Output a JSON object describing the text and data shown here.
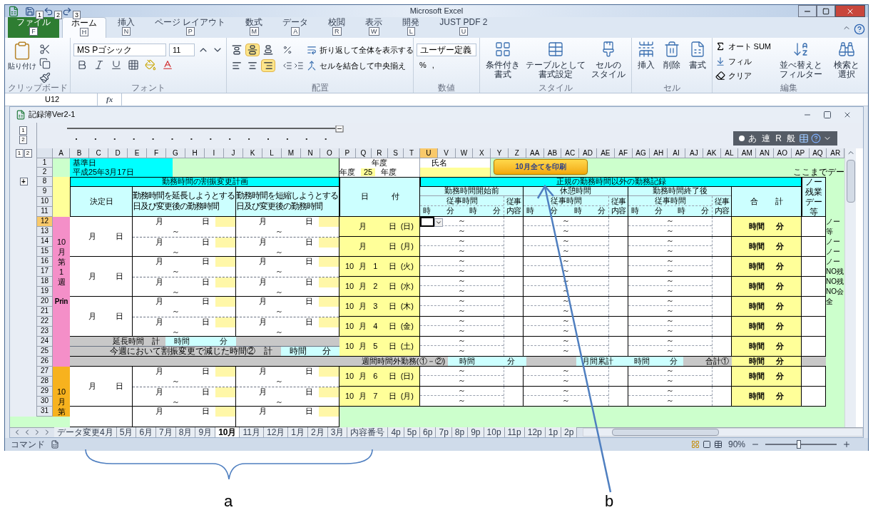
{
  "title_bar": {
    "title": "Microsoft Excel",
    "key_tips": [
      "1",
      "2",
      "3"
    ]
  },
  "ribbon": {
    "tabs": [
      {
        "label": "ファイル",
        "key": "F",
        "selected": false,
        "kind": "file"
      },
      {
        "label": "ホーム",
        "key": "H",
        "selected": true,
        "kind": "tab"
      },
      {
        "label": "挿入",
        "key": "N",
        "selected": false,
        "kind": "tab"
      },
      {
        "label": "ページ レイアウト",
        "key": "P",
        "selected": false,
        "kind": "tab"
      },
      {
        "label": "数式",
        "key": "M",
        "selected": false,
        "kind": "tab"
      },
      {
        "label": "データ",
        "key": "A",
        "selected": false,
        "kind": "tab"
      },
      {
        "label": "校閲",
        "key": "R",
        "selected": false,
        "kind": "tab"
      },
      {
        "label": "表示",
        "key": "W",
        "selected": false,
        "kind": "tab"
      },
      {
        "label": "開発",
        "key": "L",
        "selected": false,
        "kind": "tab"
      },
      {
        "label": "JUST PDF 2",
        "key": "U",
        "selected": false,
        "kind": "tab"
      }
    ],
    "clipboard": {
      "paste": "貼り付け",
      "label": "クリップボード"
    },
    "font": {
      "name": "MS Pゴシック",
      "size": "11",
      "label": "フォント"
    },
    "alignment": {
      "wrap": "折り返して全体を表示する",
      "merge": "セルを結合して中央揃え",
      "label": "配置",
      "buttons": [
        {
          "selected": false
        },
        {
          "selected": true
        },
        {
          "selected": false
        },
        {
          "selected": false
        },
        {
          "selected": false
        },
        {
          "selected": true
        }
      ]
    },
    "number": {
      "format": "ユーザー定義",
      "percent": "%",
      "comma": ",",
      "label": "数値"
    },
    "styles": {
      "items": [
        [
          "条件付き",
          "書式"
        ],
        [
          "テーブルとして",
          "書式設定"
        ],
        [
          "セルの",
          "スタイル"
        ]
      ],
      "label": "スタイル"
    },
    "cells": {
      "items": [
        "挿入",
        "削除",
        "書式"
      ],
      "label": "セル"
    },
    "editing": {
      "autosum": "オート SUM",
      "fill": "フィル",
      "clear": "クリア",
      "sort": [
        "並べ替えと",
        "フィルター"
      ],
      "find": [
        "検索と",
        "選択"
      ],
      "label": "編集"
    }
  },
  "formula_bar": {
    "name_box": "U12",
    "fx": "fx"
  },
  "workbook": {
    "title": "記録簿Ver2-1"
  },
  "outline": {
    "row_levels": [
      "1",
      "2"
    ],
    "col_levels": [
      "1",
      "2"
    ],
    "expand": "+"
  },
  "ime_toolbar": [
    "あ",
    "連",
    "R",
    "般"
  ],
  "columns": [
    {
      "label": "A",
      "selected": false
    },
    {
      "label": "B",
      "selected": false
    },
    {
      "label": "C",
      "selected": false
    },
    {
      "label": "D",
      "selected": false
    },
    {
      "label": "E",
      "selected": false
    },
    {
      "label": "F",
      "selected": false
    },
    {
      "label": "G",
      "selected": false
    },
    {
      "label": "H",
      "selected": false
    },
    {
      "label": "I",
      "selected": false
    },
    {
      "label": "J",
      "selected": false
    },
    {
      "label": "K",
      "selected": false
    },
    {
      "label": "L",
      "selected": false
    },
    {
      "label": "M",
      "selected": false
    },
    {
      "label": "N",
      "selected": false
    },
    {
      "label": "O",
      "selected": false
    },
    {
      "label": "P",
      "selected": false
    },
    {
      "label": "Q",
      "selected": false
    },
    {
      "label": "R",
      "selected": false
    },
    {
      "label": "S",
      "selected": false
    },
    {
      "label": "T",
      "selected": false
    },
    {
      "label": "U",
      "selected": true
    },
    {
      "label": "V",
      "selected": false
    },
    {
      "label": "W",
      "selected": false
    },
    {
      "label": "X",
      "selected": false
    },
    {
      "label": "Y",
      "selected": false
    },
    {
      "label": "Z",
      "selected": false
    },
    {
      "label": "AA",
      "selected": false
    },
    {
      "label": "AB",
      "selected": false
    },
    {
      "label": "AC",
      "selected": false
    },
    {
      "label": "AD",
      "selected": false
    },
    {
      "label": "AE",
      "selected": false
    },
    {
      "label": "AF",
      "selected": false
    },
    {
      "label": "AG",
      "selected": false
    },
    {
      "label": "AH",
      "selected": false
    },
    {
      "label": "AI",
      "selected": false
    },
    {
      "label": "AJ",
      "selected": false
    },
    {
      "label": "AK",
      "selected": false
    },
    {
      "label": "AL",
      "selected": false
    },
    {
      "label": "AM",
      "selected": false
    },
    {
      "label": "AN",
      "selected": false
    },
    {
      "label": "AO",
      "selected": false
    },
    {
      "label": "AP",
      "selected": false
    },
    {
      "label": "AQ",
      "selected": false
    },
    {
      "label": "AR",
      "selected": false
    }
  ],
  "rows": [
    {
      "label": "1",
      "selected": false
    },
    {
      "label": "2",
      "selected": false
    },
    {
      "label": "8",
      "selected": false
    },
    {
      "label": "9",
      "selected": false
    },
    {
      "label": "10",
      "selected": false
    },
    {
      "label": "11",
      "selected": false
    },
    {
      "label": "12",
      "selected": true
    },
    {
      "label": "13",
      "selected": false
    },
    {
      "label": "14",
      "selected": false
    },
    {
      "label": "15",
      "selected": false
    },
    {
      "label": "16",
      "selected": false
    },
    {
      "label": "17",
      "selected": false
    },
    {
      "label": "18",
      "selected": false
    },
    {
      "label": "19",
      "selected": false
    },
    {
      "label": "20",
      "selected": false
    },
    {
      "label": "21",
      "selected": false
    },
    {
      "label": "22",
      "selected": false
    },
    {
      "label": "23",
      "selected": false
    },
    {
      "label": "24",
      "selected": false
    },
    {
      "label": "25",
      "selected": false
    },
    {
      "label": "26",
      "selected": false
    },
    {
      "label": "27",
      "selected": false
    },
    {
      "label": "28",
      "selected": false
    },
    {
      "label": "29",
      "selected": false
    },
    {
      "label": "30",
      "selected": false
    },
    {
      "label": "31",
      "selected": false
    }
  ],
  "header": {
    "base_date_label": "基準日",
    "base_date": "平成25年3月17日",
    "year_label": "年度",
    "year_prefix": "年度",
    "year": "25",
    "year_suffix": "年度",
    "name_label": "氏名",
    "print_button": "10月全てを印刷",
    "note": "ここまでデー"
  },
  "plan": {
    "title": "勤務時間の割振変更計画",
    "decided": "決定日",
    "extend": [
      "勤務時間を延長しようとする",
      "日及び変更後の勤務時間"
    ],
    "shorten": [
      "勤務時間を短縮しようとする",
      "日及び変更後の勤務時間"
    ]
  },
  "date_header": [
    "日",
    "付"
  ],
  "record": {
    "title": "正規の勤務時間以外の勤務記録",
    "sections": [
      {
        "title": "勤務時間開始前",
        "sub": "従事時間",
        "content": [
          "従事",
          "内容"
        ],
        "units": [
          "時",
          "分",
          "時",
          "分"
        ]
      },
      {
        "title": "休憩時間",
        "sub": "従事時間",
        "content": [
          "従事",
          "内容"
        ],
        "units": [
          "時",
          "分",
          "時",
          "分"
        ]
      },
      {
        "title": "勤務時間終了後",
        "sub": "従事時間",
        "content": [
          "従事",
          "内容"
        ],
        "units": [
          "時",
          "分",
          "時",
          "分"
        ]
      }
    ],
    "total": [
      "合",
      "計"
    ],
    "no_overtime": "ノー残業デー等"
  },
  "weeks": [
    {
      "label": [
        "10",
        "月",
        "第",
        "1",
        "週",
        "Prin"
      ],
      "color": "#f48fc8",
      "plans": [
        {
          "decided": [
            "月",
            "日"
          ],
          "halves": [
            {
              "extend": [
                "月",
                "日",
                "～"
              ],
              "shorten": [
                "月",
                "日",
                "～"
              ]
            },
            {
              "extend": [
                "月",
                "日",
                "～"
              ],
              "shorten": [
                "月",
                "日",
                "～"
              ]
            }
          ]
        },
        {
          "decided": [
            "月",
            "日"
          ],
          "halves": [
            {
              "extend": [
                "月",
                "日",
                "～"
              ],
              "shorten": [
                "月",
                "日",
                "～"
              ]
            },
            {
              "extend": [
                "月",
                "日",
                "～"
              ],
              "shorten": [
                "月",
                "日",
                "～"
              ]
            }
          ]
        },
        {
          "decided": [
            "月",
            "日"
          ],
          "halves": [
            {
              "extend": [
                "月",
                "日",
                "～"
              ],
              "shorten": [
                "月",
                "日",
                "～"
              ]
            },
            {
              "extend": [
                "月",
                "日",
                "～"
              ],
              "shorten": [
                "月",
                "日",
                "～"
              ]
            }
          ]
        }
      ],
      "extend_total": {
        "label": "延長時間　計",
        "units": [
          "時間",
          "分"
        ]
      },
      "reduced": {
        "label": "今週において割振変更で減じた時間②　計",
        "units": [
          "時間",
          "分"
        ]
      },
      "days": [
        {
          "month": "月",
          "day": "日",
          "weekday": "(日)",
          "active": true,
          "slots": [
            [
              "～",
              "～"
            ],
            [
              "～",
              "～"
            ],
            [
              "～",
              "～"
            ]
          ],
          "total": [
            "時間",
            "分"
          ]
        },
        {
          "month": "月",
          "day": "日",
          "weekday": "(月)",
          "active": false,
          "slots": [
            [
              "～",
              "～"
            ],
            [
              "～",
              "～"
            ],
            [
              "～",
              "～"
            ]
          ],
          "total": [
            "時間",
            "分"
          ]
        },
        {
          "month_num": "10",
          "month": "月",
          "day_num": "1",
          "day": "日",
          "weekday": "(火)",
          "active": false,
          "slots": [
            [
              "～",
              "～"
            ],
            [
              "～",
              "～"
            ],
            [
              "～",
              "～"
            ]
          ],
          "total": [
            "時間",
            "分"
          ]
        },
        {
          "month_num": "10",
          "month": "月",
          "day_num": "2",
          "day": "日",
          "weekday": "(水)",
          "active": false,
          "slots": [
            [
              "～",
              "～"
            ],
            [
              "～",
              "～"
            ],
            [
              "～",
              "～"
            ]
          ],
          "total": [
            "時間",
            "分"
          ]
        },
        {
          "month_num": "10",
          "month": "月",
          "day_num": "3",
          "day": "日",
          "weekday": "(木)",
          "active": false,
          "slots": [
            [
              "～",
              "～"
            ],
            [
              "～",
              "～"
            ],
            [
              "～",
              "～"
            ]
          ],
          "total": [
            "時間",
            "分"
          ]
        },
        {
          "month_num": "10",
          "month": "月",
          "day_num": "4",
          "day": "日",
          "weekday": "(金)",
          "active": false,
          "slots": [
            [
              "～",
              "～"
            ],
            [
              "～",
              "～"
            ],
            [
              "～",
              "～"
            ]
          ],
          "total": [
            "時間",
            "分"
          ]
        },
        {
          "month_num": "10",
          "month": "月",
          "day_num": "5",
          "day": "日",
          "weekday": "(土)",
          "active": false,
          "slots": [
            [
              "～",
              "～"
            ],
            [
              "～",
              "～"
            ],
            [
              "～",
              "～"
            ]
          ],
          "total": [
            "時間",
            "分"
          ]
        }
      ]
    },
    {
      "label": [
        "10",
        "月",
        "第"
      ],
      "color": "#f7b21e",
      "plans": [
        {
          "decided": [
            "月",
            "日"
          ],
          "halves": [
            {
              "extend": [
                "月",
                "日",
                "～"
              ],
              "shorten": [
                "月",
                "日",
                "～"
              ]
            },
            {
              "extend": [
                "月",
                "日",
                "～"
              ],
              "shorten": [
                "月",
                "日",
                "～"
              ]
            }
          ]
        },
        {
          "halves": [
            {
              "extend": [
                "月",
                "日"
              ],
              "shorten": [
                "月",
                "日"
              ]
            }
          ]
        }
      ],
      "days": [
        {
          "month_num": "10",
          "month": "月",
          "day_num": "6",
          "day": "日",
          "weekday": "(日)",
          "active": false,
          "slots": [
            [
              "～",
              "～"
            ],
            [
              "～",
              "～"
            ],
            [
              "～",
              "～"
            ]
          ],
          "total": [
            "時間",
            "分"
          ]
        },
        {
          "month_num": "10",
          "month": "月",
          "day_num": "7",
          "day": "日",
          "weekday": "(月)",
          "active": false,
          "slots": [
            [
              "～",
              "～"
            ],
            [
              "～",
              "～"
            ],
            [
              "～",
              "～"
            ]
          ],
          "total": [
            "時間",
            "分"
          ]
        }
      ]
    }
  ],
  "summary": {
    "weekly": "週間時間外勤務(①－②)",
    "weekly_units": [
      "時間",
      "分"
    ],
    "monthly": "月間累計",
    "monthly_units": [
      "時間",
      "分"
    ],
    "sum": "合計①",
    "sum_units": [
      "時間",
      "分"
    ]
  },
  "side_notes": [
    "ノー",
    "等",
    "ノー",
    "ノー",
    "ノー",
    "NO残",
    "NO残",
    "NO会",
    "全"
  ],
  "sheet_tabs": [
    {
      "label": "データ変更4月",
      "selected": false
    },
    {
      "label": "5月",
      "selected": false
    },
    {
      "label": "6月",
      "selected": false
    },
    {
      "label": "7月",
      "selected": false
    },
    {
      "label": "8月",
      "selected": false
    },
    {
      "label": "9月",
      "selected": false
    },
    {
      "label": "10月",
      "selected": true
    },
    {
      "label": "11月",
      "selected": false
    },
    {
      "label": "12月",
      "selected": false
    },
    {
      "label": "1月",
      "selected": false
    },
    {
      "label": "2月",
      "selected": false
    },
    {
      "label": "3月",
      "selected": false
    },
    {
      "label": "内容番号",
      "selected": false
    },
    {
      "label": "4p",
      "selected": false
    },
    {
      "label": "5p",
      "selected": false
    },
    {
      "label": "6p",
      "selected": false
    },
    {
      "label": "7p",
      "selected": false
    },
    {
      "label": "8p",
      "selected": false
    },
    {
      "label": "9p",
      "selected": false
    },
    {
      "label": "10p",
      "selected": false
    },
    {
      "label": "11p",
      "selected": false
    },
    {
      "label": "12p",
      "selected": false
    },
    {
      "label": "1p",
      "selected": false
    },
    {
      "label": "2p",
      "selected": false
    }
  ],
  "status_bar": {
    "mode": "コマンド",
    "zoom": "90%",
    "zoom_slider": {
      "level": 0.47
    }
  },
  "annotations": [
    {
      "label": "a"
    },
    {
      "label": "b"
    }
  ]
}
